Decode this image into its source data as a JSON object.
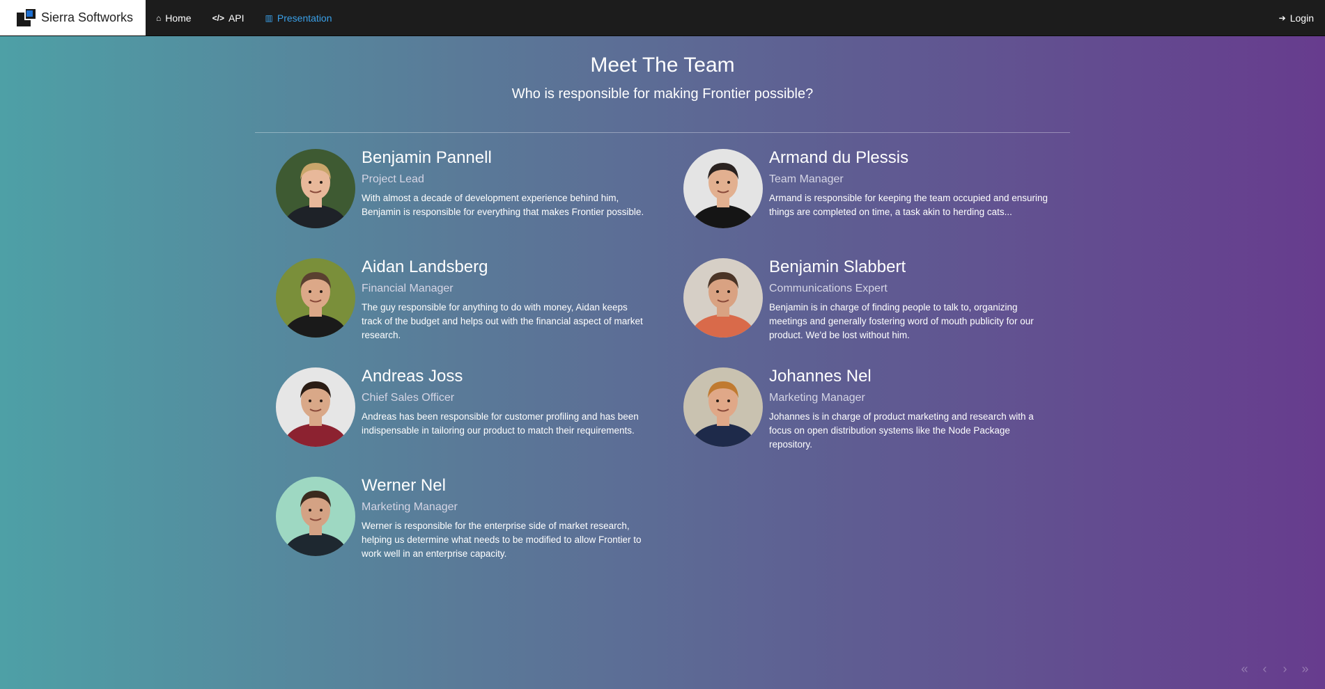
{
  "brand": {
    "name": "Sierra Softworks"
  },
  "nav": {
    "items": [
      {
        "label": "Home",
        "icon": "home-icon",
        "glyph": "⌂",
        "active": false
      },
      {
        "label": "API",
        "icon": "code-icon",
        "glyph": "</>",
        "active": false
      },
      {
        "label": "Presentation",
        "icon": "bar-chart-icon",
        "glyph": "▥",
        "active": true
      }
    ],
    "login": {
      "label": "Login",
      "icon": "login-icon",
      "glyph": "➔"
    }
  },
  "header": {
    "title": "Meet The Team",
    "subtitle": "Who is responsible for making Frontier possible?"
  },
  "team": [
    {
      "name": "Benjamin Pannell",
      "role": "Project Lead",
      "bio": "With almost a decade of development experience behind him, Benjamin is responsible for everything that makes Frontier possible.",
      "avatar": {
        "bg": "#3e5a32",
        "skin": "#e8b89a",
        "hair": "#c9a66b",
        "shirt": "#1e2228"
      }
    },
    {
      "name": "Armand du Plessis",
      "role": "Team Manager",
      "bio": "Armand is responsible for keeping the team occupied and ensuring things are completed on time, a task akin to herding cats...",
      "avatar": {
        "bg": "#e4e4e4",
        "skin": "#e2b090",
        "hair": "#2a2220",
        "shirt": "#151515"
      }
    },
    {
      "name": "Aidan Landsberg",
      "role": "Financial Manager",
      "bio": "The guy responsible for anything to do with money, Aidan keeps track of the budget and helps out with the financial aspect of market research.",
      "avatar": {
        "bg": "#7a8f3a",
        "skin": "#dca888",
        "hair": "#5a4030",
        "shirt": "#1a1a1a"
      }
    },
    {
      "name": "Benjamin Slabbert",
      "role": "Communications Expert",
      "bio": "Benjamin is in charge of finding people to talk to, organizing meetings and generally fostering word of mouth publicity for our product. We'd be lost without him.",
      "avatar": {
        "bg": "#d6cfc6",
        "skin": "#d9a282",
        "hair": "#4a3426",
        "shirt": "#d96a4a"
      }
    },
    {
      "name": "Andreas Joss",
      "role": "Chief Sales Officer",
      "bio": "Andreas has been responsible for customer profiling and has been indispensable in tailoring our product to match their requirements.",
      "avatar": {
        "bg": "#e6e6e6",
        "skin": "#d9a888",
        "hair": "#2a1c14",
        "shirt": "#8c2230"
      }
    },
    {
      "name": "Johannes Nel",
      "role": "Marketing Manager",
      "bio": "Johannes is in charge of product marketing and research with a focus on open distribution systems like the Node Package repository.",
      "avatar": {
        "bg": "#c9c2b0",
        "skin": "#e0a888",
        "hair": "#c07a30",
        "shirt": "#1e2a4a"
      }
    },
    {
      "name": "Werner Nel",
      "role": "Marketing Manager",
      "bio": "Werner is responsible for the enterprise side of market research, helping us determine what needs to be modified to allow Frontier to work well in an enterprise capacity.",
      "avatar": {
        "bg": "#9ed8c2",
        "skin": "#d4a284",
        "hair": "#3a2a1e",
        "shirt": "#1e2830"
      }
    }
  ],
  "pager": [
    "«",
    "‹",
    "›",
    "»"
  ]
}
